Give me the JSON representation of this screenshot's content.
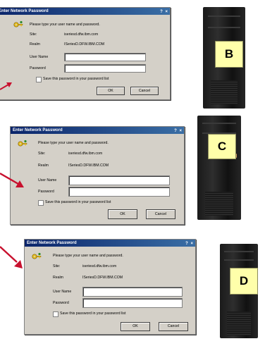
{
  "dialog": {
    "title": "Enter Network Password",
    "prompt": "Please type your user name and password.",
    "site_label": "Site:",
    "site_value": "iseriesd.dfw.ibm.com",
    "realm_label": "Realm",
    "realm_value": "ISeriesD.DFW.IBM.COM",
    "username_label": "User Name",
    "password_label": "Password",
    "save_label": "Save this password in your password list",
    "ok_label": "OK",
    "cancel_label": "Cancel"
  },
  "badges": {
    "b": "B",
    "c": "C",
    "d": "D"
  },
  "colors": {
    "arrow": "#c8102e",
    "badge_bg": "#ffffaa",
    "titlebar": "#0a246a"
  }
}
